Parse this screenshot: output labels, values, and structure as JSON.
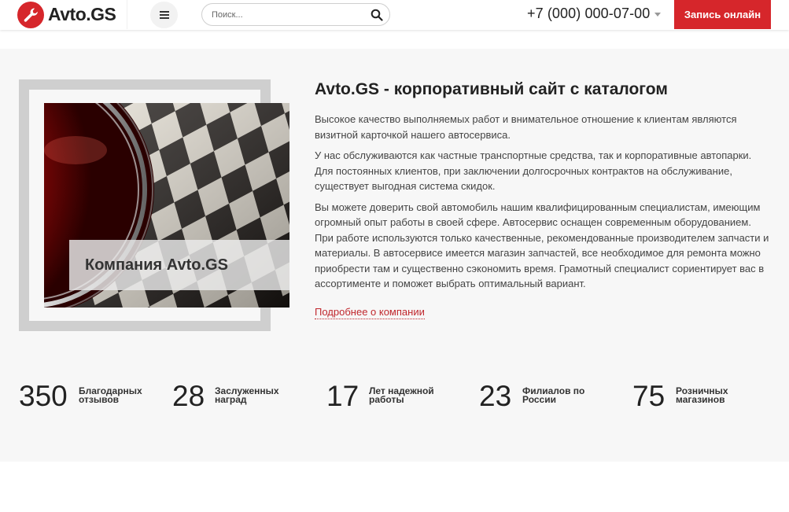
{
  "header": {
    "logo_text": "Avto.GS",
    "search_placeholder": "Поиск...",
    "phone": "+7 (000) 000-07-00",
    "cta_label": "Запись онлайн"
  },
  "about": {
    "title": "Avto.GS - корпоративный сайт с каталогом",
    "image_caption": "Компания Avto.GS",
    "paragraphs": [
      "Высокое качество выполняемых работ и внимательное отношение к клиентам являются визитной карточкой нашего автосервиса.",
      "У нас обслуживаются как частные транспортные средства, так и корпоративные автопарки. Для постоянных клиентов, при заключении долгосрочных контрактов на обслуживание, существует выгодная система скидок.",
      "Вы можете доверить свой автомобиль нашим квалифицированным специалистам, имеющим огромный опыт работы в своей сфере. Автосервис оснащен современным оборудованием. При работе используются только качественные, рекомендованные производителем запчасти и материалы. В автосервисе имеется магазин запчастей, все необходимое для ремонта можно приобрести там и существенно сэкономить время. Грамотный специалист сориентирует вас в ассортименте и поможет выбрать оптимальный вариант."
    ],
    "more_link": "Подробнее о компании"
  },
  "stats": [
    {
      "value": "350",
      "label": "Благодарных отзывов"
    },
    {
      "value": "28",
      "label": "Заслуженных наград"
    },
    {
      "value": "17",
      "label": "Лет надежной работы"
    },
    {
      "value": "23",
      "label": "Филиалов по России"
    },
    {
      "value": "75",
      "label": "Розничных магазинов"
    }
  ],
  "colors": {
    "accent": "#d6262b",
    "link": "#c0272d",
    "band_background": "#f7f7f7",
    "frame": "#cfcfcf"
  },
  "icons": {
    "logo": "wrench-icon",
    "menu": "hamburger-menu-icon",
    "search": "search-icon",
    "phone_dropdown": "caret-down-icon"
  }
}
